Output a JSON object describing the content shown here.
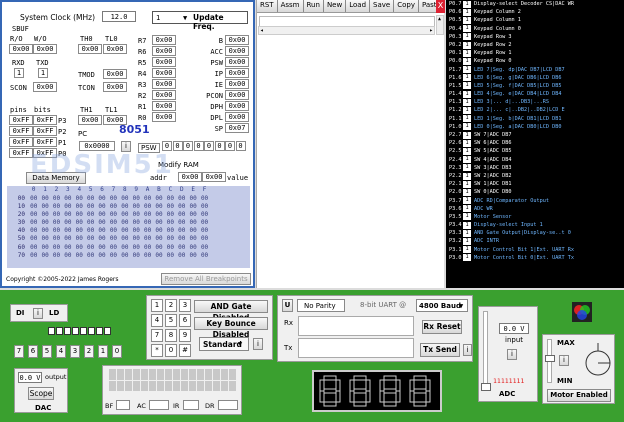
{
  "sim": {
    "clock_label": "System Clock (MHz)",
    "clock_value": "12.0",
    "sbuf": "SBUF",
    "speed_value": "1",
    "update_btn": "Update Freq.",
    "ro": "R/O",
    "wo": "W/O",
    "th0": "TH0",
    "tl0": "TL0",
    "ro_val": "0x00",
    "wo_val": "0x00",
    "th0_val": "0x00",
    "tl0_val": "0x00",
    "rxd": "RXD",
    "txd": "TXD",
    "rxd_val": "1",
    "txd_val": "1",
    "tmod": "TMOD",
    "tmod_val": "0x00",
    "scon": "SCON",
    "scon_val": "0x00",
    "tcon": "TCON",
    "tcon_val": "0x00",
    "pins": "pins",
    "bits": "bits",
    "th1": "TH1",
    "tl1": "TL1",
    "th1_val": "0x00",
    "tl1_val": "0x00",
    "ports": [
      {
        "pins": "0xFF",
        "bits": "0xFF",
        "name": "P3"
      },
      {
        "pins": "0xFF",
        "bits": "0xFF",
        "name": "P2"
      },
      {
        "pins": "0xFF",
        "bits": "0xFF",
        "name": "P1"
      },
      {
        "pins": "0xFF",
        "bits": "0xFF",
        "name": "P0"
      }
    ],
    "pc_label": "PC",
    "pc_val": "0x0000",
    "chip": "8051",
    "psw_label": "PSW",
    "psw_bits": [
      "0",
      "0",
      "0",
      "0",
      "0",
      "0",
      "0",
      "0"
    ],
    "regs": [
      {
        "name": "R7",
        "val": "0x00"
      },
      {
        "name": "R6",
        "val": "0x00"
      },
      {
        "name": "R5",
        "val": "0x00"
      },
      {
        "name": "R4",
        "val": "0x00"
      },
      {
        "name": "R3",
        "val": "0x00"
      },
      {
        "name": "R2",
        "val": "0x00"
      },
      {
        "name": "R1",
        "val": "0x00"
      },
      {
        "name": "R0",
        "val": "0x00"
      }
    ],
    "sfrs": [
      {
        "name": "B",
        "val": "0x00"
      },
      {
        "name": "ACC",
        "val": "0x00"
      },
      {
        "name": "PSW",
        "val": "0x00"
      },
      {
        "name": "IP",
        "val": "0x00"
      },
      {
        "name": "IE",
        "val": "0x00"
      },
      {
        "name": "PCON",
        "val": "0x00"
      },
      {
        "name": "DPH",
        "val": "0x00"
      },
      {
        "name": "DPL",
        "val": "0x00"
      },
      {
        "name": "SP",
        "val": "0x07"
      }
    ],
    "modify_ram": "Modify RAM",
    "data_memory": "Data Memory",
    "addr_label": "addr",
    "addr_val": "0x00",
    "value_label": "value",
    "value_val": "0x00",
    "mem_cols": [
      "0",
      "1",
      "2",
      "3",
      "4",
      "5",
      "6",
      "7",
      "8",
      "9",
      "A",
      "B",
      "C",
      "D",
      "E",
      "F"
    ],
    "mem_rows": [
      "00",
      "10",
      "20",
      "30",
      "40",
      "50",
      "60",
      "70"
    ],
    "mem_cell": "00",
    "copyright": "Copyright ©2005-2022 James Rogers",
    "remove_bp": "Remove All Breakpoints",
    "watermark": "EDSIM51"
  },
  "toolbar": [
    "RST",
    "Assm",
    "Run",
    "New",
    "Load",
    "Save",
    "Copy",
    "Paste"
  ],
  "close_x": "X",
  "pins": [
    {
      "p": "P0.7",
      "v": "1",
      "d": "Display-select Decoder CS|DAC WR"
    },
    {
      "p": "P0.6",
      "v": "1",
      "d": "Keypad Column 2"
    },
    {
      "p": "P0.5",
      "v": "1",
      "d": "Keypad Column 1"
    },
    {
      "p": "P0.4",
      "v": "1",
      "d": "Keypad Column 0"
    },
    {
      "p": "P0.3",
      "v": "1",
      "d": "Keypad Row 3"
    },
    {
      "p": "P0.2",
      "v": "1",
      "d": "Keypad Row 2"
    },
    {
      "p": "P0.1",
      "v": "1",
      "d": "Keypad Row 1"
    },
    {
      "p": "P0.0",
      "v": "1",
      "d": "Keypad Row 0"
    },
    {
      "p": "P1.7",
      "v": "1",
      "d": "LED 7|Seg. dp|DAC DB7|LCD DB7"
    },
    {
      "p": "P1.6",
      "v": "1",
      "d": "LED 6|Seg. g|DAC DB6|LCD DB6"
    },
    {
      "p": "P1.5",
      "v": "1",
      "d": "LED 5|Seg. f|DAC DB5|LCD DB5"
    },
    {
      "p": "P1.4",
      "v": "1",
      "d": "LED 4|Seg. e|DAC DB4|LCD DB4"
    },
    {
      "p": "P1.3",
      "v": "1",
      "d": "LED 3|... d|...DB3|...RS"
    },
    {
      "p": "P1.2",
      "v": "1",
      "d": "LED 2|... c|..DB2|..DB2|LCD E"
    },
    {
      "p": "P1.1",
      "v": "1",
      "d": "LED 1|Seg. b|DAC DB1|LCD DB1"
    },
    {
      "p": "P1.0",
      "v": "1",
      "d": "LED 0|Seg. a|DAC DB0|LCD DB0"
    },
    {
      "p": "P2.7",
      "v": "1",
      "d": "SW 7|ADC DB7"
    },
    {
      "p": "P2.6",
      "v": "1",
      "d": "SW 6|ADC DB6"
    },
    {
      "p": "P2.5",
      "v": "1",
      "d": "SW 5|ADC DB5"
    },
    {
      "p": "P2.4",
      "v": "1",
      "d": "SW 4|ADC DB4"
    },
    {
      "p": "P2.3",
      "v": "1",
      "d": "SW 3|ADC DB3"
    },
    {
      "p": "P2.2",
      "v": "1",
      "d": "SW 2|ADC DB2"
    },
    {
      "p": "P2.1",
      "v": "1",
      "d": "SW 1|ADC DB1"
    },
    {
      "p": "P2.0",
      "v": "1",
      "d": "SW 0|ADC DB0"
    },
    {
      "p": "P3.7",
      "v": "1",
      "d": "ADC RD|Comparator Output"
    },
    {
      "p": "P3.6",
      "v": "1",
      "d": "ADC WR"
    },
    {
      "p": "P3.5",
      "v": "1",
      "d": "Motor Sensor"
    },
    {
      "p": "P3.4",
      "v": "1",
      "d": "Display-select Input 1"
    },
    {
      "p": "P3.3",
      "v": "1",
      "d": "AND Gate Output|Display-se..t 0"
    },
    {
      "p": "P3.2",
      "v": "1",
      "d": "ADC INTR"
    },
    {
      "p": "P3.1",
      "v": "1",
      "d": "Motor Control Bit 1|Ext. UART Rx"
    },
    {
      "p": "P3.0",
      "v": "1",
      "d": "Motor Control Bit 0|Ext. UART Tx"
    }
  ],
  "bottom": {
    "di": "DI",
    "i_btn": "i",
    "ld": "LD",
    "switches": [
      "7",
      "6",
      "5",
      "4",
      "3",
      "2",
      "1",
      "0"
    ],
    "dac_val": "0.0 V",
    "dac_output": "output",
    "scope": "Scope",
    "dac": "DAC",
    "bf": "BF",
    "ac": "AC",
    "ir": "IR",
    "dr": "DR",
    "keys": [
      "1",
      "2",
      "3",
      "4",
      "5",
      "6",
      "7",
      "8",
      "9",
      "*",
      "0",
      "#"
    ],
    "and_gate": "AND Gate Disabled",
    "key_bounce": "Key Bounce Disabled",
    "standard": "Standard",
    "u": "U",
    "parity": "No Parity",
    "uart_label": "8-bit UART @",
    "baud": "4800 Baud",
    "rx": "Rx",
    "tx": "Tx",
    "rx_reset": "Rx Reset",
    "tx_send": "Tx Send",
    "adc_val": "0.0 V",
    "adc_input": "input",
    "adc_bits": "11111111",
    "adc": "ADC",
    "max": "MAX",
    "min": "MIN",
    "motor": "Motor Enabled"
  },
  "colors": {
    "accent": "#3567b5",
    "green": "#3aa02f",
    "led_red": "#e32020"
  }
}
